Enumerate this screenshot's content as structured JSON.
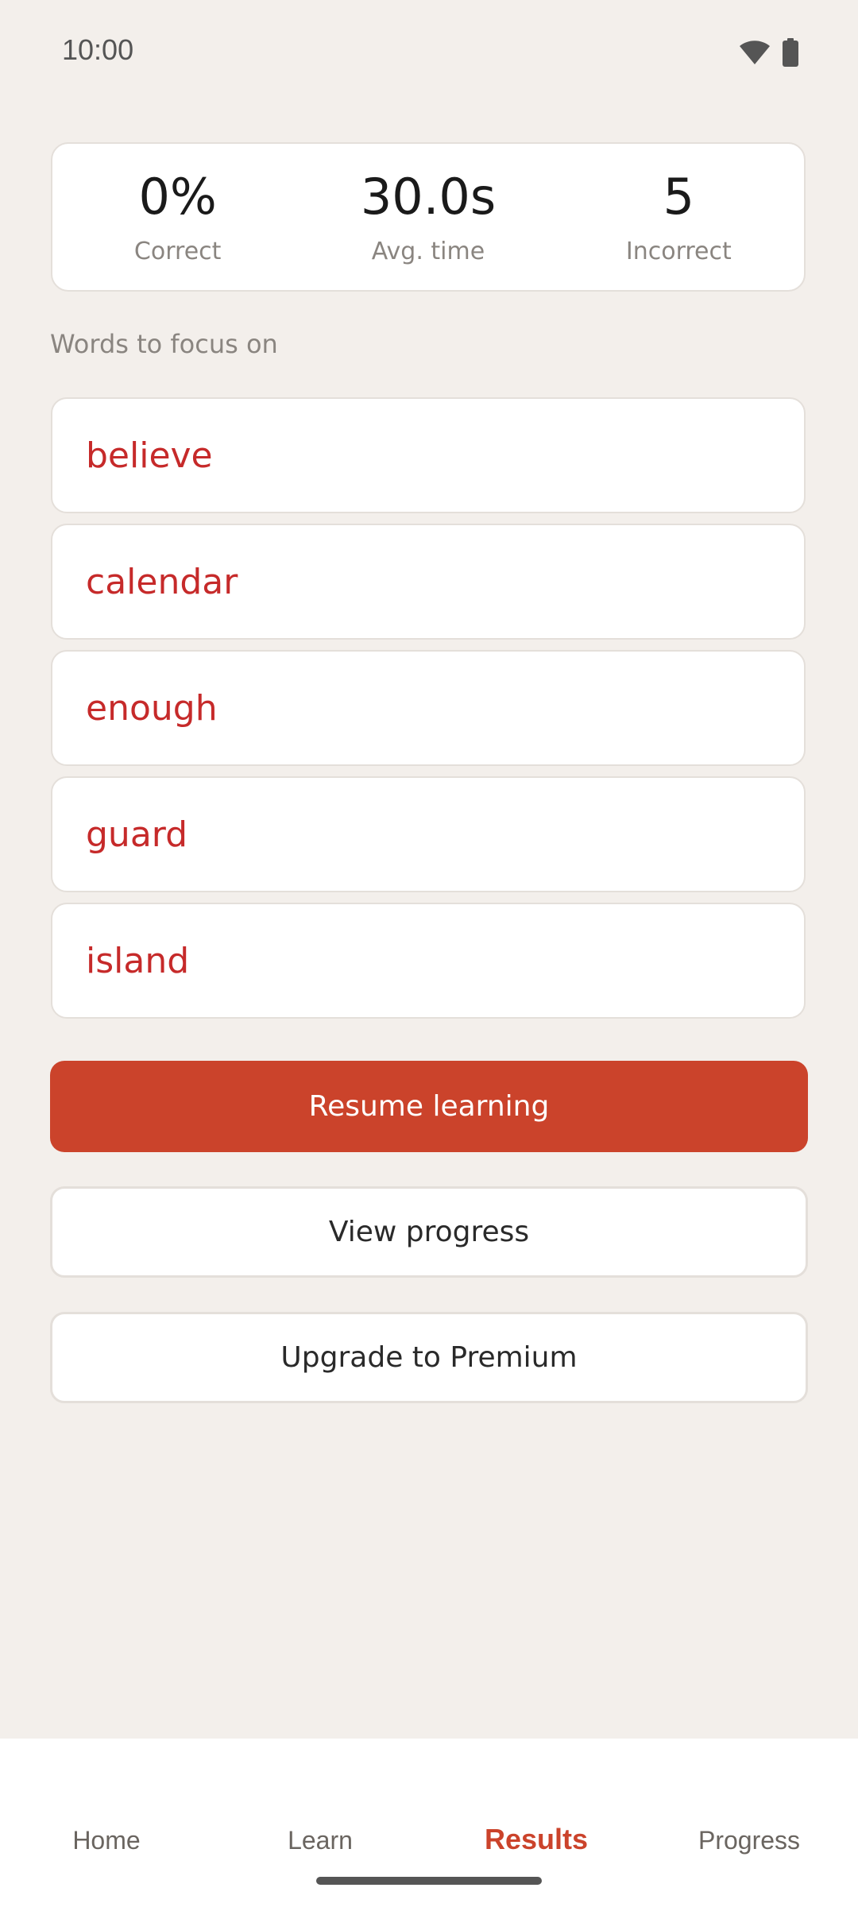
{
  "status_bar": {
    "time": "10:00",
    "icons": [
      "wifi-icon",
      "battery-icon"
    ]
  },
  "stats": {
    "correct": {
      "value": "0%",
      "label": "Correct"
    },
    "avg_time": {
      "value": "30.0s",
      "label": "Avg. time"
    },
    "incorrect": {
      "value": "5",
      "label": "Incorrect"
    }
  },
  "focus_section": {
    "title": "Words to focus on",
    "words": [
      "believe",
      "calendar",
      "enough",
      "guard",
      "island"
    ]
  },
  "actions": {
    "resume_label": "Resume learning",
    "view_progress_label": "View progress",
    "upgrade_label": "Upgrade to Premium"
  },
  "bottom_nav": {
    "items": [
      {
        "label": "Home"
      },
      {
        "label": "Learn"
      },
      {
        "label": "Results",
        "active": true
      },
      {
        "label": "Progress"
      }
    ]
  },
  "colors": {
    "accent": "#cb432b",
    "word_text": "#c62a2a",
    "background": "#f3efeb"
  }
}
